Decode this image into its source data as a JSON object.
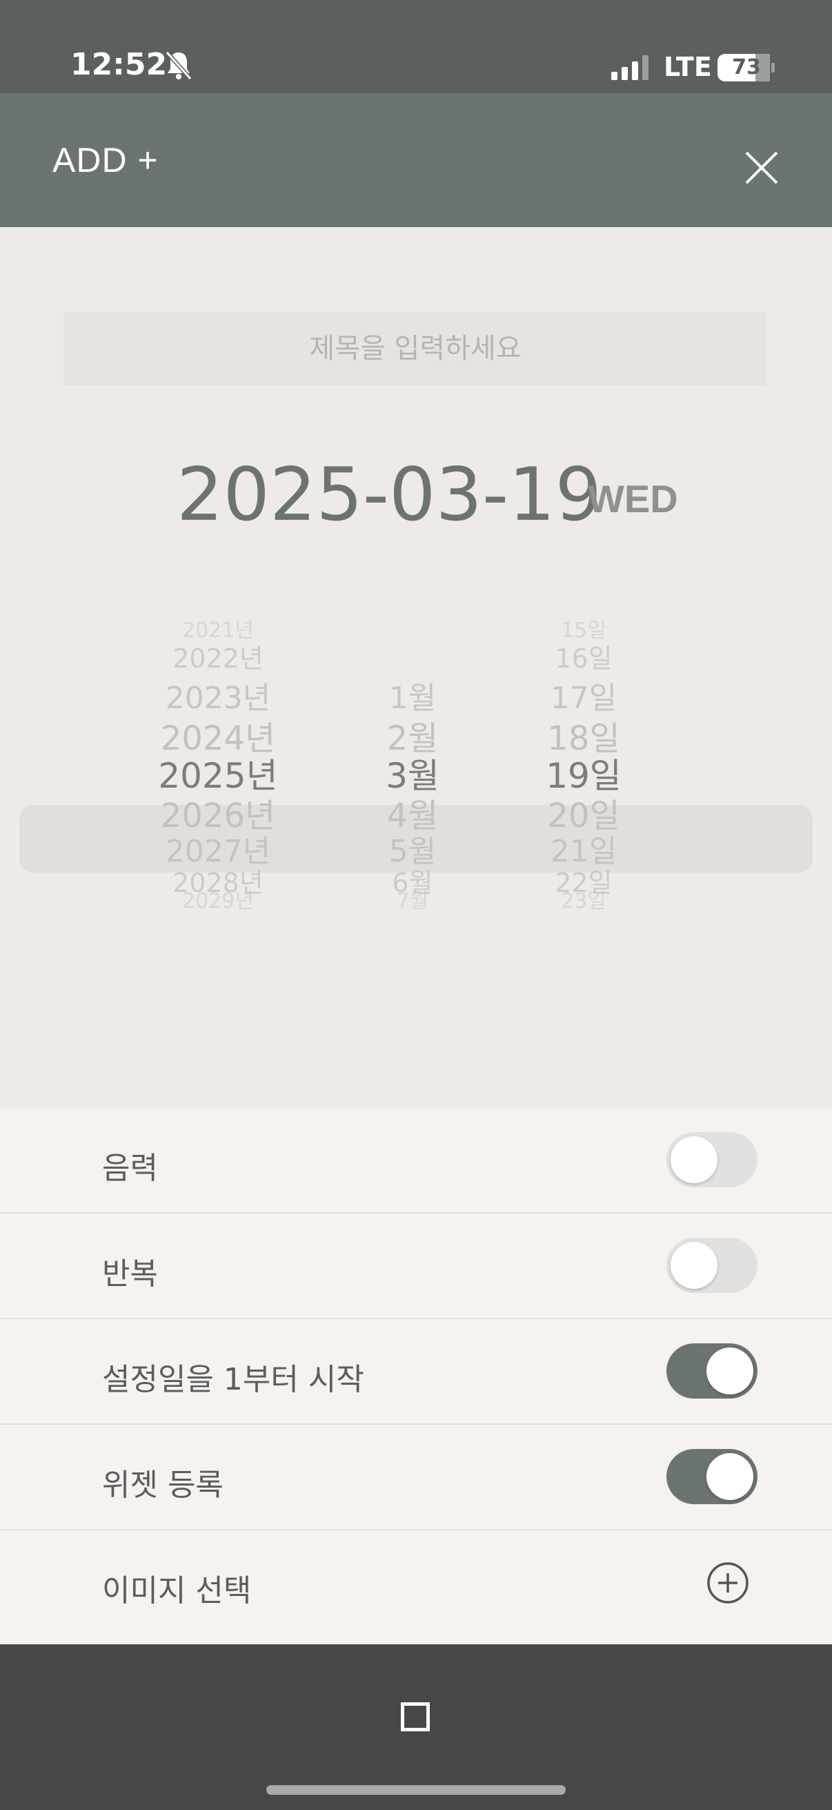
{
  "status_bar": {
    "time": "12:52",
    "network": "LTE",
    "battery": "73"
  },
  "header": {
    "title": "ADD +"
  },
  "title_input": {
    "value": "",
    "placeholder": "제목을 입력하세요"
  },
  "selected_date": {
    "date": "2025-03-19",
    "weekday": "WED"
  },
  "picker": {
    "years": [
      "2021년",
      "2022년",
      "2023년",
      "2024년",
      "2025년",
      "2026년",
      "2027년",
      "2028년",
      "2029년"
    ],
    "months": [
      "1월",
      "2월",
      "3월",
      "4월",
      "5월",
      "6월",
      "7월"
    ],
    "days": [
      "15일",
      "16일",
      "17일",
      "18일",
      "19일",
      "20일",
      "21일",
      "22일",
      "23일"
    ],
    "selected": {
      "year": "2025년",
      "month": "3월",
      "day": "19일"
    }
  },
  "settings": [
    {
      "label": "음력",
      "toggle": false
    },
    {
      "label": "반복",
      "toggle": false
    },
    {
      "label": "설정일을 1부터 시작",
      "toggle": true
    },
    {
      "label": "위젯 등록",
      "toggle": true
    },
    {
      "label": "이미지 선택",
      "action": "plus-icon"
    }
  ],
  "colors": {
    "accent": "#6c746f",
    "status_bar": "#5b605c",
    "nav_bar": "#474747"
  }
}
